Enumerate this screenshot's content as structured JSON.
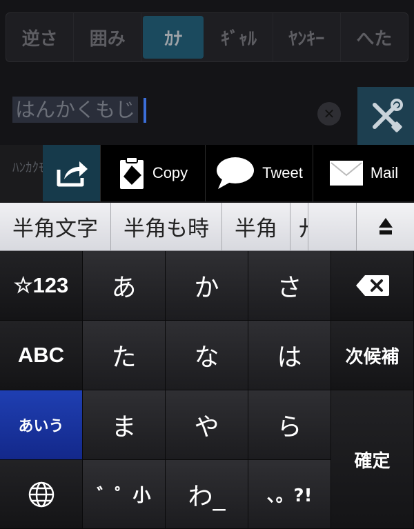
{
  "tabs": [
    {
      "label": "逆さ",
      "active": false
    },
    {
      "label": "囲み",
      "active": false
    },
    {
      "label": "ｶﾅ",
      "active": true
    },
    {
      "label": "ｷﾞｬﾙ",
      "active": false
    },
    {
      "label": "ﾔﾝｷｰ",
      "active": false
    },
    {
      "label": "へた",
      "active": false
    }
  ],
  "input": {
    "value": "はんかくもじ",
    "clear_icon": "clear-x-icon",
    "tools_icon": "wrench-screwdriver-icon"
  },
  "result_preview": "ﾊﾝｶｸﾓｼﾞ",
  "actions": {
    "share_icon": "share-arrow-icon",
    "copy": "Copy",
    "tweet": "Tweet",
    "mail": "Mail"
  },
  "candidates": [
    "半角文字",
    "半角も時",
    "半角",
    "廾"
  ],
  "keyboard": {
    "row1": {
      "mode": "☆123",
      "k1": "あ",
      "k2": "か",
      "k3": "さ"
    },
    "row2": {
      "mode": "ABC",
      "k1": "た",
      "k2": "な",
      "k3": "は",
      "next": "次候補"
    },
    "row3": {
      "mode": "あいう",
      "k1": "ま",
      "k2": "や",
      "k3": "ら",
      "confirm": "確定"
    },
    "row4": {
      "k1": "゛゜小",
      "k2": "わ_",
      "k3": "、。?!"
    }
  },
  "colors": {
    "active_tab": "#1b4a5e",
    "accent_blue": "#1f3fb2",
    "caret": "#3b6ed8"
  }
}
